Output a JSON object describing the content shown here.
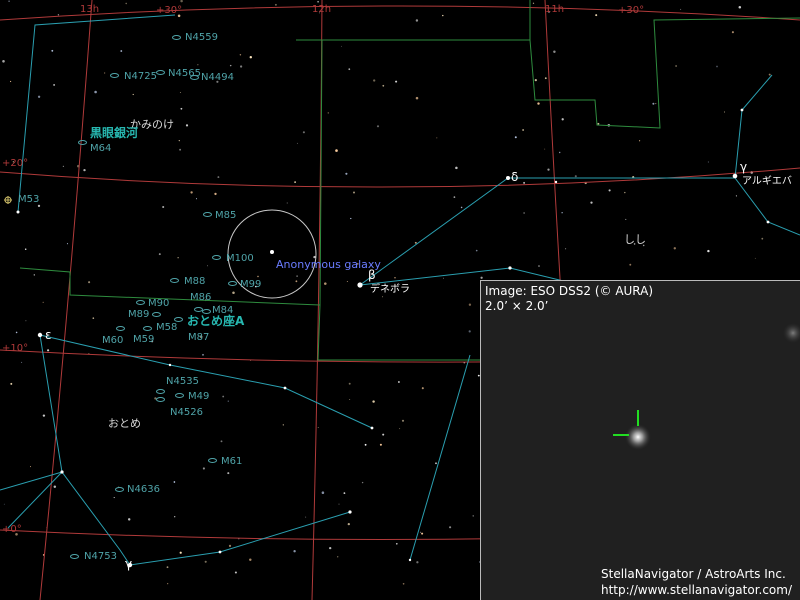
{
  "grid_labels": {
    "ra": [
      "13h",
      "12h",
      "11h"
    ],
    "dec": [
      "+30°",
      "+30°",
      "+20°",
      "+10°",
      "+0°"
    ]
  },
  "objects": {
    "n4559": "N4559",
    "n4565": "N4565",
    "n4725": "N4725",
    "n4494": "N4494",
    "m64": "M64",
    "m53": "M53",
    "m85": "M85",
    "m100": "M100",
    "m88": "M88",
    "m99": "M99",
    "m90": "M90",
    "m86": "M86",
    "m84": "M84",
    "m89": "M89",
    "m58": "M58",
    "m60": "M60",
    "m59": "M59",
    "m87": "M87",
    "n4535": "N4535",
    "m49": "M49",
    "n4526": "N4526",
    "m61": "M61",
    "n4636": "N4636",
    "n4753": "N4753"
  },
  "named_regions": {
    "black_eye": "黒眼銀河",
    "virgo_cluster": "おとめ座A"
  },
  "constellations": {
    "coma": "かみのけ",
    "virgo": "おとめ",
    "leo": "しし"
  },
  "stars": {
    "delta": "δ",
    "beta": "β",
    "beta_name": "デネボラ",
    "gamma_leo": "γ",
    "gamma_leo_name": "アルギエバ",
    "epsilon": "ε",
    "gamma_vir": "γ"
  },
  "target": {
    "label": "Anonymous galaxy"
  },
  "inset": {
    "caption": "Image: ESO DSS2 (© AURA)",
    "fov": "2.0’ × 2.0’",
    "credit": "StellaNavigator / AstroArts Inc.",
    "url": "http://www.stellanavigator.com/"
  },
  "colors": {
    "background": "#000000",
    "grid": "#b03a3a",
    "constellation_line": "#2a9fb0",
    "boundary": "#2e8b3e",
    "object_label": "#4fa3a8",
    "target_label": "#6a7cff",
    "inset_bg": "#202020",
    "crosshair": "#22dd22"
  }
}
